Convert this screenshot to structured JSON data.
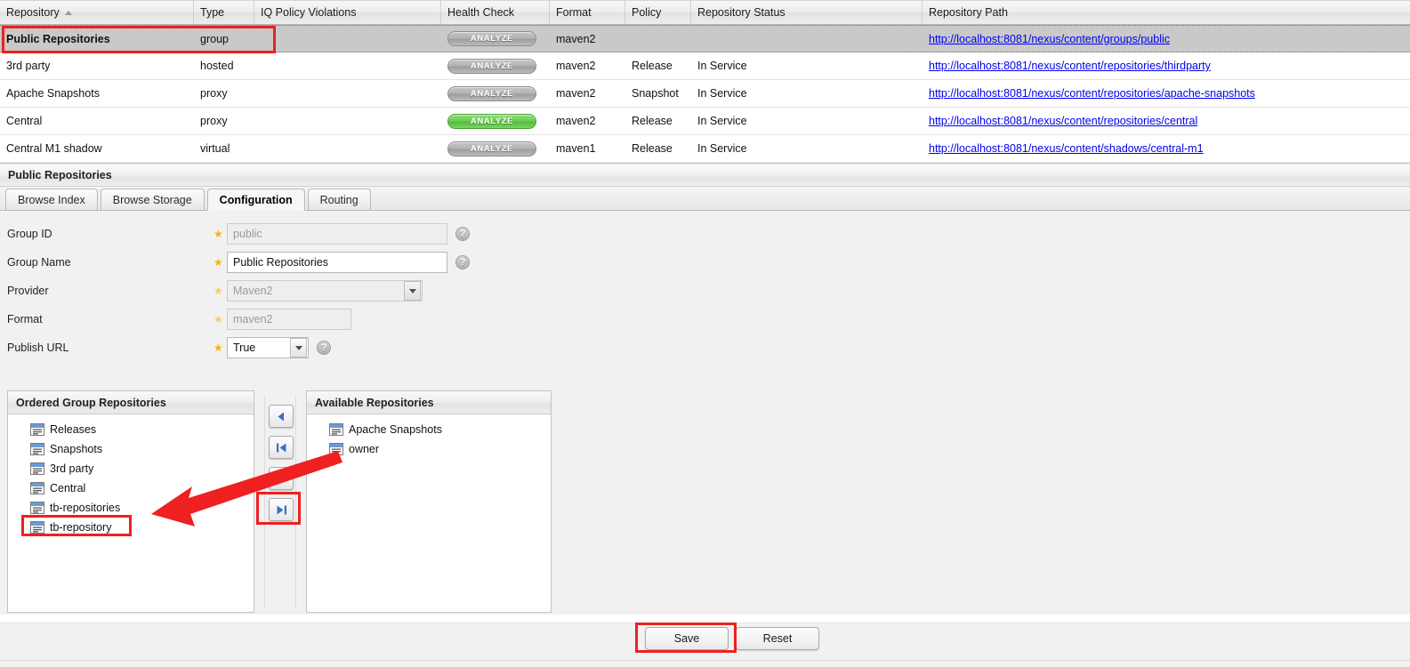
{
  "grid": {
    "columns": [
      {
        "key": "repository",
        "label": "Repository",
        "sorted": "asc"
      },
      {
        "key": "type",
        "label": "Type"
      },
      {
        "key": "iq_policy_violations",
        "label": "IQ Policy Violations"
      },
      {
        "key": "health_check",
        "label": "Health Check"
      },
      {
        "key": "format",
        "label": "Format"
      },
      {
        "key": "policy",
        "label": "Policy"
      },
      {
        "key": "repository_status",
        "label": "Repository Status"
      },
      {
        "key": "repository_path",
        "label": "Repository Path"
      }
    ],
    "analyze_label": "ANALYZE",
    "rows": [
      {
        "repository": "Public Repositories",
        "type": "group",
        "iq_policy_violations": "",
        "health_check": "ANALYZE",
        "health_state": "gray",
        "format": "maven2",
        "policy": "",
        "repository_status": "",
        "repository_path": "http://localhost:8081/nexus/content/groups/public",
        "selected": true
      },
      {
        "repository": "3rd party",
        "type": "hosted",
        "iq_policy_violations": "",
        "health_check": "ANALYZE",
        "health_state": "gray",
        "format": "maven2",
        "policy": "Release",
        "repository_status": "In Service",
        "repository_path": "http://localhost:8081/nexus/content/repositories/thirdparty",
        "selected": false
      },
      {
        "repository": "Apache Snapshots",
        "type": "proxy",
        "iq_policy_violations": "",
        "health_check": "ANALYZE",
        "health_state": "gray",
        "format": "maven2",
        "policy": "Snapshot",
        "repository_status": "In Service",
        "repository_path": "http://localhost:8081/nexus/content/repositories/apache-snapshots",
        "selected": false
      },
      {
        "repository": "Central",
        "type": "proxy",
        "iq_policy_violations": "",
        "health_check": "ANALYZE",
        "health_state": "green",
        "format": "maven2",
        "policy": "Release",
        "repository_status": "In Service",
        "repository_path": "http://localhost:8081/nexus/content/repositories/central",
        "selected": false
      },
      {
        "repository": "Central M1 shadow",
        "type": "virtual",
        "iq_policy_violations": "",
        "health_check": "ANALYZE",
        "health_state": "gray",
        "format": "maven1",
        "policy": "Release",
        "repository_status": "In Service",
        "repository_path": "http://localhost:8081/nexus/content/shadows/central-m1",
        "selected": false
      }
    ]
  },
  "detail": {
    "title": "Public Repositories",
    "tabs": [
      {
        "label": "Browse Index",
        "active": false
      },
      {
        "label": "Browse Storage",
        "active": false
      },
      {
        "label": "Configuration",
        "active": true
      },
      {
        "label": "Routing",
        "active": false
      }
    ],
    "form": {
      "group_id": {
        "label": "Group ID",
        "value": "public",
        "disabled": true,
        "required": true,
        "has_help": true
      },
      "group_name": {
        "label": "Group Name",
        "value": "Public Repositories",
        "disabled": false,
        "required": true,
        "has_help": true
      },
      "provider": {
        "label": "Provider",
        "value": "Maven2",
        "disabled": true,
        "required": true,
        "has_help": false
      },
      "format": {
        "label": "Format",
        "value": "maven2",
        "disabled": true,
        "required": true,
        "has_help": false
      },
      "publish_url": {
        "label": "Publish URL",
        "value": "True",
        "disabled": false,
        "required": true,
        "has_help": true
      }
    },
    "ordered_group": {
      "title": "Ordered Group Repositories",
      "items": [
        {
          "label": "Releases"
        },
        {
          "label": "Snapshots"
        },
        {
          "label": "3rd party"
        },
        {
          "label": "Central"
        },
        {
          "label": "tb-repositories"
        },
        {
          "label": "tb-repository",
          "highlighted": true
        }
      ]
    },
    "available": {
      "title": "Available Repositories",
      "items": [
        {
          "label": "Apache Snapshots"
        },
        {
          "label": "owner"
        }
      ]
    },
    "transfer_buttons": [
      {
        "name": "move-left-button",
        "icon": "arrow-left-icon",
        "highlighted": true
      },
      {
        "name": "move-all-left-button",
        "icon": "arrow-left-all-icon",
        "highlighted": false
      },
      {
        "name": "move-right-button",
        "icon": "arrow-right-icon",
        "highlighted": false
      },
      {
        "name": "move-all-right-button",
        "icon": "arrow-right-all-icon",
        "highlighted": false
      }
    ],
    "actions": {
      "save": "Save",
      "reset": "Reset"
    }
  },
  "annotations": {
    "highlight_color": "#ee2020",
    "arrow_color": "#ee2020",
    "targets": [
      "selected-repository-row",
      "tb-repository-list-item",
      "move-left-button",
      "save-button"
    ]
  }
}
